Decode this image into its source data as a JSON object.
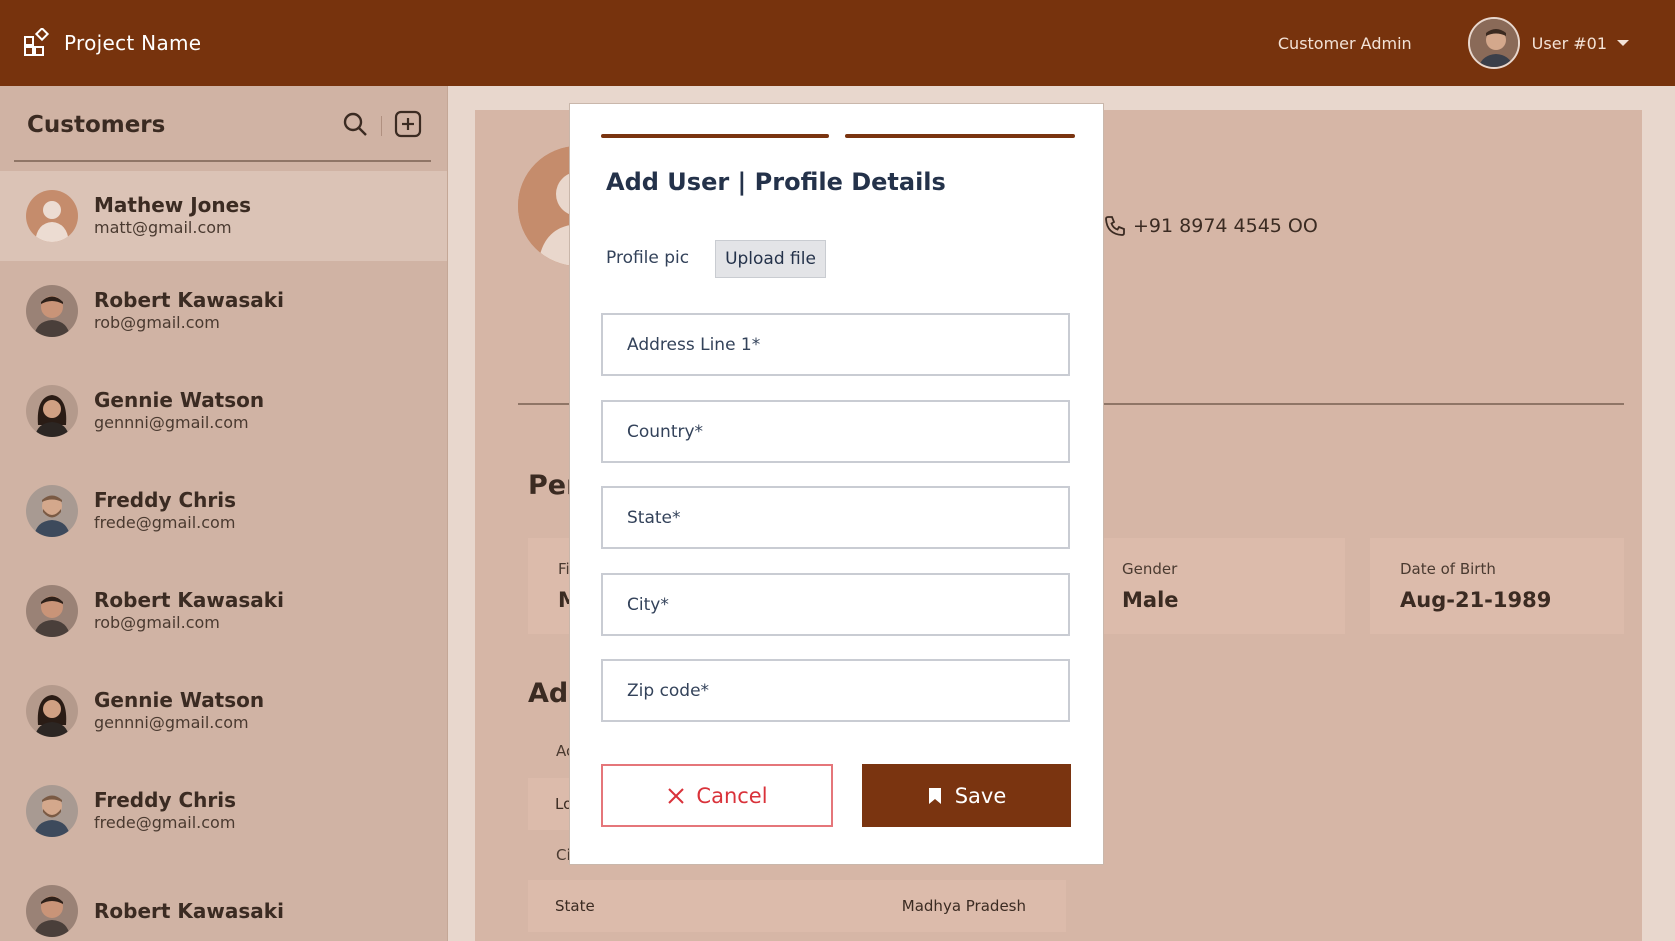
{
  "topbar": {
    "project_name": "Project Name",
    "role": "Customer Admin",
    "user": "User #01",
    "brand_color": "#77330d"
  },
  "sidebar": {
    "title": "Customers",
    "customers": [
      {
        "name": "Mathew Jones",
        "email": "matt@gmail.com",
        "avatar": "placeholder"
      },
      {
        "name": "Robert Kawasaki",
        "email": "rob@gmail.com",
        "avatar": "photo-man"
      },
      {
        "name": "Gennie Watson",
        "email": "gennni@gmail.com",
        "avatar": "photo-woman"
      },
      {
        "name": "Freddy Chris",
        "email": "frede@gmail.com",
        "avatar": "photo-man-beard"
      },
      {
        "name": "Robert Kawasaki",
        "email": "rob@gmail.com",
        "avatar": "photo-man"
      },
      {
        "name": "Gennie Watson",
        "email": "gennni@gmail.com",
        "avatar": "photo-woman"
      },
      {
        "name": "Freddy Chris",
        "email": "frede@gmail.com",
        "avatar": "photo-man-beard"
      },
      {
        "name": "Robert Kawasaki",
        "email": "",
        "avatar": "photo-man"
      }
    ]
  },
  "main": {
    "phone": "+91 8974 4545 OO",
    "personal_section_title_visible": "Per",
    "address_section_title_visible": "Add",
    "first_name_label_visible": "Fi",
    "first_name_value_visible": "M",
    "gender_label": "Gender",
    "gender_value": "Male",
    "dob_label": "Date of Birth",
    "dob_value": "Aug-21-1989",
    "addr_stub_1": "Ac",
    "addr_stub_2": "Lo",
    "addr_stub_3": "Ci",
    "state_label": "State",
    "state_value": "Madhya Pradesh"
  },
  "modal": {
    "title": "Add User | Profile Details",
    "profile_pic_label": "Profile pic",
    "upload_label": "Upload file",
    "fields": {
      "address_line_1": "Address Line 1*",
      "country": "Country*",
      "state": "State*",
      "city": "City*",
      "zip": "Zip code*"
    },
    "cancel_label": "Cancel",
    "save_label": "Save",
    "progress_step": 2,
    "progress_total": 2
  }
}
